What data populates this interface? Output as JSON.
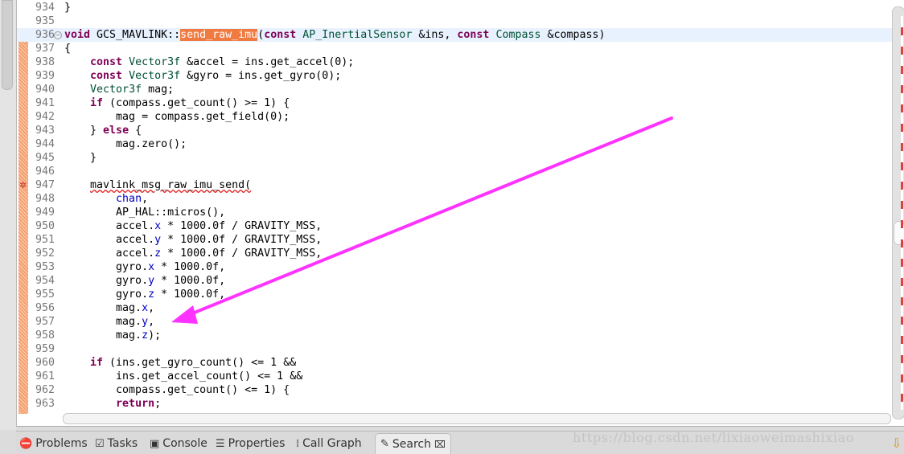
{
  "editor": {
    "current_line": 936,
    "lines": [
      {
        "n": "934",
        "tokens": [
          [
            "",
            "}"
          ]
        ]
      },
      {
        "n": "935",
        "tokens": []
      },
      {
        "n": "936",
        "tokens": [
          [
            "k",
            "void"
          ],
          [
            "",
            " GCS_MAVLINK::"
          ],
          [
            "hl",
            "send_raw_imu"
          ],
          [
            "",
            "("
          ],
          [
            "k",
            "const"
          ],
          [
            "",
            " "
          ],
          [
            "t",
            "AP_InertialSensor"
          ],
          [
            "",
            " &ins, "
          ],
          [
            "k",
            "const"
          ],
          [
            "",
            " "
          ],
          [
            "t",
            "Compass"
          ],
          [
            "",
            " &compass)"
          ]
        ]
      },
      {
        "n": "937",
        "tokens": [
          [
            "",
            "{"
          ]
        ]
      },
      {
        "n": "938",
        "tokens": [
          [
            "",
            "    "
          ],
          [
            "k",
            "const"
          ],
          [
            "",
            " "
          ],
          [
            "t",
            "Vector3f"
          ],
          [
            "",
            " &accel = ins.get_accel(0);"
          ]
        ]
      },
      {
        "n": "939",
        "tokens": [
          [
            "",
            "    "
          ],
          [
            "k",
            "const"
          ],
          [
            "",
            " "
          ],
          [
            "t",
            "Vector3f"
          ],
          [
            "",
            " &gyro = ins.get_gyro(0);"
          ]
        ]
      },
      {
        "n": "940",
        "tokens": [
          [
            "",
            "    "
          ],
          [
            "t",
            "Vector3f"
          ],
          [
            "",
            " mag;"
          ]
        ]
      },
      {
        "n": "941",
        "tokens": [
          [
            "",
            "    "
          ],
          [
            "k",
            "if"
          ],
          [
            "",
            " (compass.get_count() >= 1) {"
          ]
        ]
      },
      {
        "n": "942",
        "tokens": [
          [
            "",
            "        mag = compass.get_field(0);"
          ]
        ]
      },
      {
        "n": "943",
        "tokens": [
          [
            "",
            "    } "
          ],
          [
            "k",
            "else"
          ],
          [
            "",
            " {"
          ]
        ]
      },
      {
        "n": "944",
        "tokens": [
          [
            "",
            "        mag.zero();"
          ]
        ]
      },
      {
        "n": "945",
        "tokens": [
          [
            "",
            "    }"
          ]
        ]
      },
      {
        "n": "946",
        "tokens": []
      },
      {
        "n": "947",
        "tokens": [
          [
            "",
            "    "
          ],
          [
            "err",
            "mavlink_msg_raw_imu_send("
          ]
        ]
      },
      {
        "n": "948",
        "tokens": [
          [
            "",
            "        "
          ],
          [
            "f",
            "chan"
          ],
          [
            "",
            ","
          ]
        ]
      },
      {
        "n": "949",
        "tokens": [
          [
            "",
            "        AP_HAL::micros(),"
          ]
        ]
      },
      {
        "n": "950",
        "tokens": [
          [
            "",
            "        accel."
          ],
          [
            "f",
            "x"
          ],
          [
            "",
            " * 1000.0f / GRAVITY_MSS,"
          ]
        ]
      },
      {
        "n": "951",
        "tokens": [
          [
            "",
            "        accel."
          ],
          [
            "f",
            "y"
          ],
          [
            "",
            " * 1000.0f / GRAVITY_MSS,"
          ]
        ]
      },
      {
        "n": "952",
        "tokens": [
          [
            "",
            "        accel."
          ],
          [
            "f",
            "z"
          ],
          [
            "",
            " * 1000.0f / GRAVITY_MSS,"
          ]
        ]
      },
      {
        "n": "953",
        "tokens": [
          [
            "",
            "        gyro."
          ],
          [
            "f",
            "x"
          ],
          [
            "",
            " * 1000.0f,"
          ]
        ]
      },
      {
        "n": "954",
        "tokens": [
          [
            "",
            "        gyro."
          ],
          [
            "f",
            "y"
          ],
          [
            "",
            " * 1000.0f,"
          ]
        ]
      },
      {
        "n": "955",
        "tokens": [
          [
            "",
            "        gyro."
          ],
          [
            "f",
            "z"
          ],
          [
            "",
            " * 1000.0f,"
          ]
        ]
      },
      {
        "n": "956",
        "tokens": [
          [
            "",
            "        mag."
          ],
          [
            "f",
            "x"
          ],
          [
            "",
            ","
          ]
        ]
      },
      {
        "n": "957",
        "tokens": [
          [
            "",
            "        mag."
          ],
          [
            "f",
            "y"
          ],
          [
            "",
            ","
          ]
        ]
      },
      {
        "n": "958",
        "tokens": [
          [
            "",
            "        mag."
          ],
          [
            "f",
            "z"
          ],
          [
            "",
            ");"
          ]
        ]
      },
      {
        "n": "959",
        "tokens": []
      },
      {
        "n": "960",
        "tokens": [
          [
            "",
            "    "
          ],
          [
            "k",
            "if"
          ],
          [
            "",
            " (ins.get_gyro_count() <= 1 &&"
          ]
        ]
      },
      {
        "n": "961",
        "tokens": [
          [
            "",
            "        ins.get_accel_count() <= 1 &&"
          ]
        ]
      },
      {
        "n": "962",
        "tokens": [
          [
            "",
            "        compass.get_count() <= 1) {"
          ]
        ]
      },
      {
        "n": "963",
        "tokens": [
          [
            "",
            "        "
          ],
          [
            "k",
            "return"
          ],
          [
            "",
            ";"
          ]
        ]
      }
    ]
  },
  "tabs": [
    {
      "label": "Problems",
      "icon": "problems-icon",
      "glyph": "⛔"
    },
    {
      "label": "Tasks",
      "icon": "tasks-icon",
      "glyph": "☑"
    },
    {
      "label": "Console",
      "icon": "console-icon",
      "glyph": "▣"
    },
    {
      "label": "Properties",
      "icon": "properties-icon",
      "glyph": "☰"
    },
    {
      "label": "Call Graph",
      "icon": "call-graph-icon",
      "glyph": "⁞"
    },
    {
      "label": "Search",
      "icon": "search-icon",
      "glyph": "✎",
      "active": true,
      "close": "⌧"
    }
  ],
  "watermark": "https://blog.csdn.net/lixiaoweimashixiao",
  "annotation": {
    "color": "#ff33ff"
  },
  "colors": {
    "keyword": "#7f0055",
    "type": "#005032",
    "field": "#0000c0",
    "highlight": "#f07a40"
  }
}
